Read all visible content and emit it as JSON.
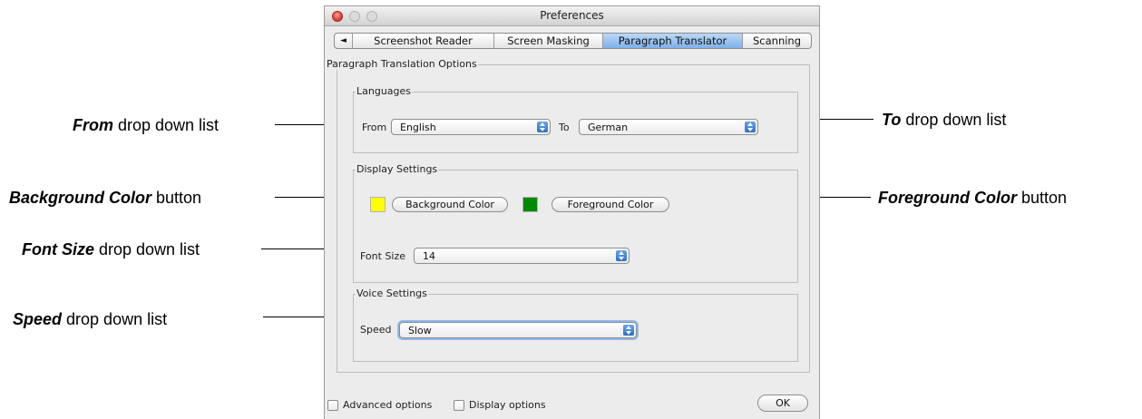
{
  "window": {
    "title": "Preferences"
  },
  "tabs": [
    {
      "label": "◄"
    },
    {
      "label": "Screenshot Reader"
    },
    {
      "label": "Screen Masking"
    },
    {
      "label": "Paragraph Translator",
      "selected": true
    },
    {
      "label": "Scanning"
    }
  ],
  "options_group": {
    "label": "Paragraph Translation Options"
  },
  "languages": {
    "label": "Languages",
    "from_label": "From",
    "from_value": "English",
    "to_label": "To",
    "to_value": "German"
  },
  "display": {
    "label": "Display Settings",
    "background_button": "Background Color",
    "foreground_button": "Foreground Color",
    "background_color": "#ffff00",
    "foreground_color": "#008a00",
    "font_size_label": "Font Size",
    "font_size_value": "14"
  },
  "voice": {
    "label": "Voice Settings",
    "speed_label": "Speed",
    "speed_value": "Slow"
  },
  "footer": {
    "advanced_label": "Advanced options",
    "display_label": "Display options",
    "ok_label": "OK"
  },
  "annotations": {
    "from": {
      "bold": "From",
      "text": " drop down list"
    },
    "to": {
      "bold": "To",
      "text": " drop down list"
    },
    "background": {
      "bold": "Background Color",
      "text": " button"
    },
    "foreground": {
      "bold": "Foreground Color",
      "text": " button"
    },
    "font_size": {
      "bold": "Font Size",
      "text": " drop down list"
    },
    "speed": {
      "bold": "Speed",
      "text": " drop down list"
    }
  }
}
